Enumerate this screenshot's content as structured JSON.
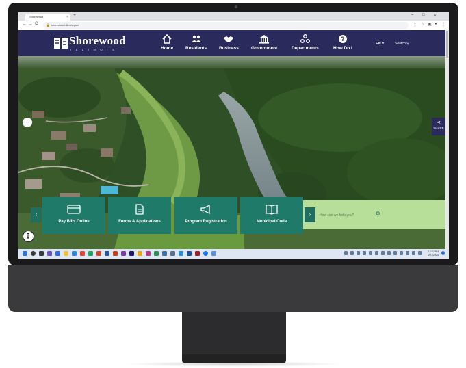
{
  "browser": {
    "tab_title": "Shorewood",
    "tab_close": "×",
    "new_tab": "+",
    "url": "shorewood.illinois.gov/",
    "window_controls": [
      "–",
      "□",
      "✕"
    ],
    "nav_buttons": [
      "←",
      "→",
      "C"
    ]
  },
  "site": {
    "logo_text": "Shorewood",
    "logo_sub": "ILLINOIS",
    "nav": [
      {
        "label": "Home",
        "icon": "home-icon"
      },
      {
        "label": "Residents",
        "icon": "people-icon"
      },
      {
        "label": "Business",
        "icon": "handshake-icon"
      },
      {
        "label": "Government",
        "icon": "capitol-icon"
      },
      {
        "label": "Departments",
        "icon": "org-chart-icon"
      },
      {
        "label": "How Do I",
        "icon": "question-icon"
      }
    ],
    "language": "EN ▾",
    "search_label": "Search ⚲",
    "share_label": "SHARE",
    "quick_links": [
      {
        "label": "Pay Bills Online",
        "icon": "credit-card-icon"
      },
      {
        "label": "Forms & Applications",
        "icon": "document-icon"
      },
      {
        "label": "Program Registration",
        "icon": "megaphone-icon"
      },
      {
        "label": "Municipal Code",
        "icon": "book-icon"
      }
    ],
    "quick_search_placeholder": "How can we help you?",
    "prev_arrow": "‹",
    "next_arrow": "›"
  },
  "taskbar": {
    "time": "12:52 PM",
    "date": "6/27/2024"
  },
  "colors": {
    "brand_navy": "#2b2a5c",
    "quicklink_green": "#1f7a69",
    "search_band": "#b7df9a"
  }
}
